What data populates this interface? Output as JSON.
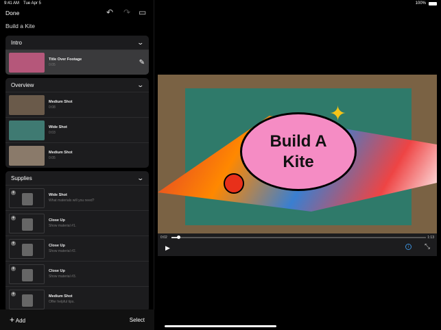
{
  "status": {
    "time": "9:41 AM",
    "date": "Tue Apr 5",
    "battery": "100%"
  },
  "toolbar": {
    "done": "Done",
    "undo_icon": "↶",
    "redo_icon": "↷",
    "add_clip_icon": "▭"
  },
  "project_title": "Build a Kite",
  "sections": [
    {
      "title": "Intro",
      "rows": [
        {
          "title": "Title Over Footage",
          "sub": "0:05",
          "selected": true
        }
      ]
    },
    {
      "title": "Overview",
      "rows": [
        {
          "title": "Medium Shot",
          "sub": "0:08"
        },
        {
          "title": "Wide Shot",
          "sub": "0:03"
        },
        {
          "title": "Medium Shot",
          "sub": "0:05"
        }
      ]
    },
    {
      "title": "Supplies",
      "rows": [
        {
          "title": "Wide Shot",
          "sub": "What materials will you need?"
        },
        {
          "title": "Close Up",
          "sub": "Show material #1."
        },
        {
          "title": "Close Up",
          "sub": "Show material #2."
        },
        {
          "title": "Close Up",
          "sub": "Show material #3."
        },
        {
          "title": "Medium Shot",
          "sub": "Offer helpful tips."
        }
      ]
    }
  ],
  "bottom": {
    "add": "Add",
    "select": "Select"
  },
  "video": {
    "title_line1": "Build A",
    "title_line2": "Kite",
    "current": "0:02",
    "total": "1:13",
    "progress": 0.027
  }
}
